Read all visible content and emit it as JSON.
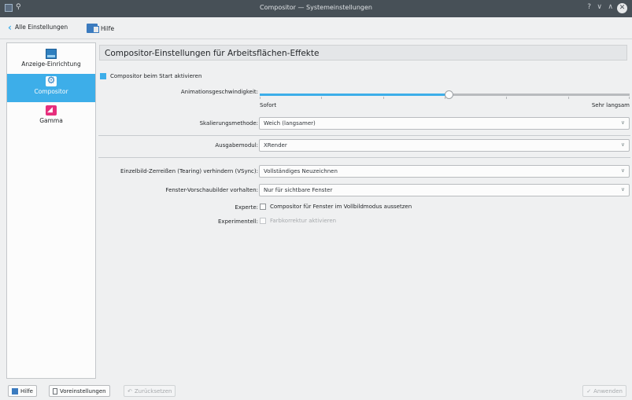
{
  "window": {
    "title": "Compositor — Systemeinstellungen",
    "controls": {
      "help": "?",
      "minimize": "∨",
      "maximize": "∧",
      "close": "✕"
    }
  },
  "toolbar": {
    "back_label": "Alle Einstellungen",
    "help_label": "Hilfe"
  },
  "sidebar": {
    "items": [
      {
        "label": "Anzeige-Einrichtung",
        "icon": "monitor-icon",
        "selected": false
      },
      {
        "label": "Compositor",
        "icon": "gear-icon",
        "selected": true
      },
      {
        "label": "Gamma",
        "icon": "gamma-icon",
        "selected": false
      }
    ]
  },
  "main": {
    "title": "Compositor-Einstellungen für Arbeitsflächen-Effekte",
    "start_checkbox": {
      "label": "Compositor beim Start aktivieren",
      "checked": true
    },
    "animation": {
      "label": "Animationsgeschwindigkeit:",
      "min_label": "Sofort",
      "max_label": "Sehr langsam",
      "value": 0.51
    },
    "scaling": {
      "label": "Skalierungsmethode:",
      "value": "Weich (langsamer)"
    },
    "backend": {
      "label": "Ausgabemodul:",
      "value": "XRender"
    },
    "vsync": {
      "label": "Einzelbild-Zerreißen (Tearing) verhindern (VSync):",
      "value": "Vollständiges Neuzeichnen"
    },
    "thumbnails": {
      "label": "Fenster-Vorschaubilder vorhalten:",
      "value": "Nur für sichtbare Fenster"
    },
    "expert": {
      "label": "Experte:",
      "checkbox_label": "Compositor für Fenster im Vollbildmodus aussetzen",
      "checked": false
    },
    "experimental": {
      "label": "Experimentell:",
      "checkbox_label": "Farbkorrektur aktivieren",
      "checked": false,
      "disabled": true
    }
  },
  "bottom": {
    "help_label": "Hilfe",
    "defaults_label": "Voreinstellungen",
    "reset_label": "Zurücksetzen",
    "apply_label": "Anwenden"
  },
  "colors": {
    "accent": "#3daee9",
    "titlebar": "#475057"
  }
}
